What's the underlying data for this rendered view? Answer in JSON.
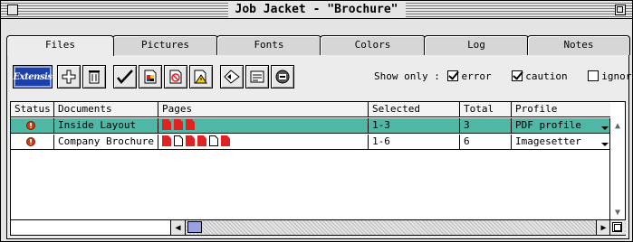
{
  "window": {
    "title": "Job Jacket - \"Brochure\""
  },
  "tabs": [
    {
      "label": "Files",
      "active": true
    },
    {
      "label": "Pictures",
      "active": false
    },
    {
      "label": "Fonts",
      "active": false
    },
    {
      "label": "Colors",
      "active": false
    },
    {
      "label": "Log",
      "active": false
    },
    {
      "label": "Notes",
      "active": false
    }
  ],
  "toolbar": {
    "logo_label": "Extensis",
    "icons": [
      "add-icon",
      "trash-icon",
      "checkmark-icon",
      "document-color-icon",
      "document-stop-icon",
      "document-warning-icon",
      "collect-icon",
      "report-icon",
      "print-icon"
    ]
  },
  "filters": {
    "show_only_label": "Show only :",
    "error": {
      "label": "error",
      "checked": true
    },
    "caution": {
      "label": "caution",
      "checked": true
    },
    "ignore": {
      "label": "ignore",
      "checked": false
    }
  },
  "table": {
    "columns": [
      "Status",
      "Documents",
      "Pages",
      "Selected",
      "Total",
      "Profile"
    ],
    "rows": [
      {
        "status": "error-icon",
        "document": "Inside Layout",
        "pages": [
          "red",
          "red",
          "red"
        ],
        "selected": "1-3",
        "total": "3",
        "profile": "PDF profile",
        "highlighted": true
      },
      {
        "status": "error-icon",
        "document": "Company Brochure",
        "pages": [
          "red",
          "white",
          "red",
          "red",
          "white",
          "red"
        ],
        "selected": "1-6",
        "total": "6",
        "profile": "Imagesetter",
        "highlighted": false
      }
    ]
  },
  "colors": {
    "selection": "#4fb7a6",
    "page_error": "#e02222",
    "status_error": "#d03a14",
    "logo_bg": "#1c3fa8"
  }
}
